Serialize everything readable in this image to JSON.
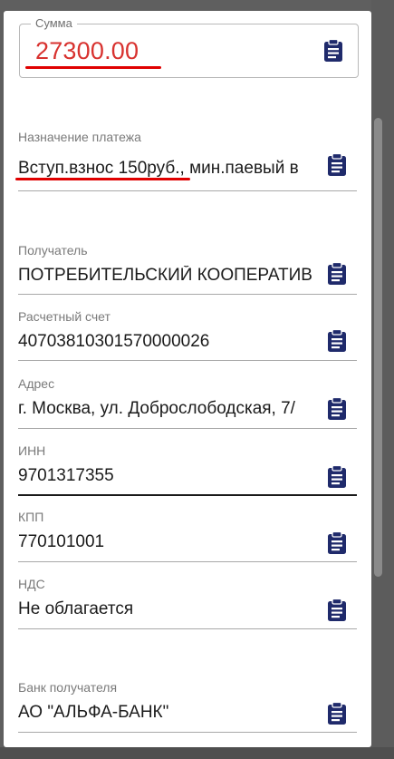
{
  "amount": {
    "label": "Сумма",
    "value": "27300.00",
    "icon": "clipboard-icon"
  },
  "fields": {
    "purpose": {
      "label": "Назначение платежа",
      "value": "Вступ.взнос 150руб., мин.паевый в"
    },
    "recipient": {
      "label": "Получатель",
      "value": "ПОТРЕБИТЕЛЬСКИЙ КООПЕРАТИВ"
    },
    "account": {
      "label": "Расчетный счет",
      "value": "40703810301570000026"
    },
    "address": {
      "label": "Адрес",
      "value": "г. Москва, ул. Доброслободская, 7/"
    },
    "inn": {
      "label": "ИНН",
      "value": "9701317355"
    },
    "kpp": {
      "label": "КПП",
      "value": "770101001"
    },
    "vat": {
      "label": "НДС",
      "value": "Не облагается"
    },
    "bank": {
      "label": "Банк получателя",
      "value": "АО \"АЛЬФА-БАНК\""
    }
  },
  "colors": {
    "accent_red": "#d8322f",
    "icon_navy": "#1f2a6b",
    "annotation_red": "#e00000"
  }
}
